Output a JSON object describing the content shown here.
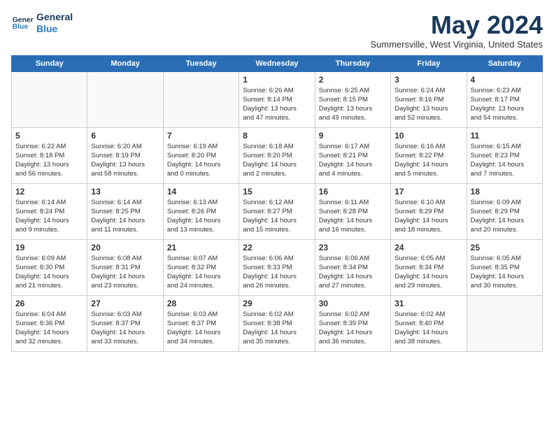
{
  "header": {
    "logo_line1": "General",
    "logo_line2": "Blue",
    "month_title": "May 2024",
    "subtitle": "Summersville, West Virginia, United States"
  },
  "days_of_week": [
    "Sunday",
    "Monday",
    "Tuesday",
    "Wednesday",
    "Thursday",
    "Friday",
    "Saturday"
  ],
  "weeks": [
    [
      {
        "day": "",
        "info": ""
      },
      {
        "day": "",
        "info": ""
      },
      {
        "day": "",
        "info": ""
      },
      {
        "day": "1",
        "info": "Sunrise: 6:26 AM\nSunset: 8:14 PM\nDaylight: 13 hours\nand 47 minutes."
      },
      {
        "day": "2",
        "info": "Sunrise: 6:25 AM\nSunset: 8:15 PM\nDaylight: 13 hours\nand 49 minutes."
      },
      {
        "day": "3",
        "info": "Sunrise: 6:24 AM\nSunset: 8:16 PM\nDaylight: 13 hours\nand 52 minutes."
      },
      {
        "day": "4",
        "info": "Sunrise: 6:23 AM\nSunset: 8:17 PM\nDaylight: 13 hours\nand 54 minutes."
      }
    ],
    [
      {
        "day": "5",
        "info": "Sunrise: 6:22 AM\nSunset: 8:18 PM\nDaylight: 13 hours\nand 56 minutes."
      },
      {
        "day": "6",
        "info": "Sunrise: 6:20 AM\nSunset: 8:19 PM\nDaylight: 13 hours\nand 58 minutes."
      },
      {
        "day": "7",
        "info": "Sunrise: 6:19 AM\nSunset: 8:20 PM\nDaylight: 14 hours\nand 0 minutes."
      },
      {
        "day": "8",
        "info": "Sunrise: 6:18 AM\nSunset: 8:20 PM\nDaylight: 14 hours\nand 2 minutes."
      },
      {
        "day": "9",
        "info": "Sunrise: 6:17 AM\nSunset: 8:21 PM\nDaylight: 14 hours\nand 4 minutes."
      },
      {
        "day": "10",
        "info": "Sunrise: 6:16 AM\nSunset: 8:22 PM\nDaylight: 14 hours\nand 5 minutes."
      },
      {
        "day": "11",
        "info": "Sunrise: 6:15 AM\nSunset: 8:23 PM\nDaylight: 14 hours\nand 7 minutes."
      }
    ],
    [
      {
        "day": "12",
        "info": "Sunrise: 6:14 AM\nSunset: 8:24 PM\nDaylight: 14 hours\nand 9 minutes."
      },
      {
        "day": "13",
        "info": "Sunrise: 6:14 AM\nSunset: 8:25 PM\nDaylight: 14 hours\nand 11 minutes."
      },
      {
        "day": "14",
        "info": "Sunrise: 6:13 AM\nSunset: 8:26 PM\nDaylight: 14 hours\nand 13 minutes."
      },
      {
        "day": "15",
        "info": "Sunrise: 6:12 AM\nSunset: 8:27 PM\nDaylight: 14 hours\nand 15 minutes."
      },
      {
        "day": "16",
        "info": "Sunrise: 6:11 AM\nSunset: 8:28 PM\nDaylight: 14 hours\nand 16 minutes."
      },
      {
        "day": "17",
        "info": "Sunrise: 6:10 AM\nSunset: 8:29 PM\nDaylight: 14 hours\nand 18 minutes."
      },
      {
        "day": "18",
        "info": "Sunrise: 6:09 AM\nSunset: 8:29 PM\nDaylight: 14 hours\nand 20 minutes."
      }
    ],
    [
      {
        "day": "19",
        "info": "Sunrise: 6:09 AM\nSunset: 8:30 PM\nDaylight: 14 hours\nand 21 minutes."
      },
      {
        "day": "20",
        "info": "Sunrise: 6:08 AM\nSunset: 8:31 PM\nDaylight: 14 hours\nand 23 minutes."
      },
      {
        "day": "21",
        "info": "Sunrise: 6:07 AM\nSunset: 8:32 PM\nDaylight: 14 hours\nand 24 minutes."
      },
      {
        "day": "22",
        "info": "Sunrise: 6:06 AM\nSunset: 8:33 PM\nDaylight: 14 hours\nand 26 minutes."
      },
      {
        "day": "23",
        "info": "Sunrise: 6:06 AM\nSunset: 8:34 PM\nDaylight: 14 hours\nand 27 minutes."
      },
      {
        "day": "24",
        "info": "Sunrise: 6:05 AM\nSunset: 8:34 PM\nDaylight: 14 hours\nand 29 minutes."
      },
      {
        "day": "25",
        "info": "Sunrise: 6:05 AM\nSunset: 8:35 PM\nDaylight: 14 hours\nand 30 minutes."
      }
    ],
    [
      {
        "day": "26",
        "info": "Sunrise: 6:04 AM\nSunset: 8:36 PM\nDaylight: 14 hours\nand 32 minutes."
      },
      {
        "day": "27",
        "info": "Sunrise: 6:03 AM\nSunset: 8:37 PM\nDaylight: 14 hours\nand 33 minutes."
      },
      {
        "day": "28",
        "info": "Sunrise: 6:03 AM\nSunset: 8:37 PM\nDaylight: 14 hours\nand 34 minutes."
      },
      {
        "day": "29",
        "info": "Sunrise: 6:02 AM\nSunset: 8:38 PM\nDaylight: 14 hours\nand 35 minutes."
      },
      {
        "day": "30",
        "info": "Sunrise: 6:02 AM\nSunset: 8:39 PM\nDaylight: 14 hours\nand 36 minutes."
      },
      {
        "day": "31",
        "info": "Sunrise: 6:02 AM\nSunset: 8:40 PM\nDaylight: 14 hours\nand 38 minutes."
      },
      {
        "day": "",
        "info": ""
      }
    ]
  ]
}
